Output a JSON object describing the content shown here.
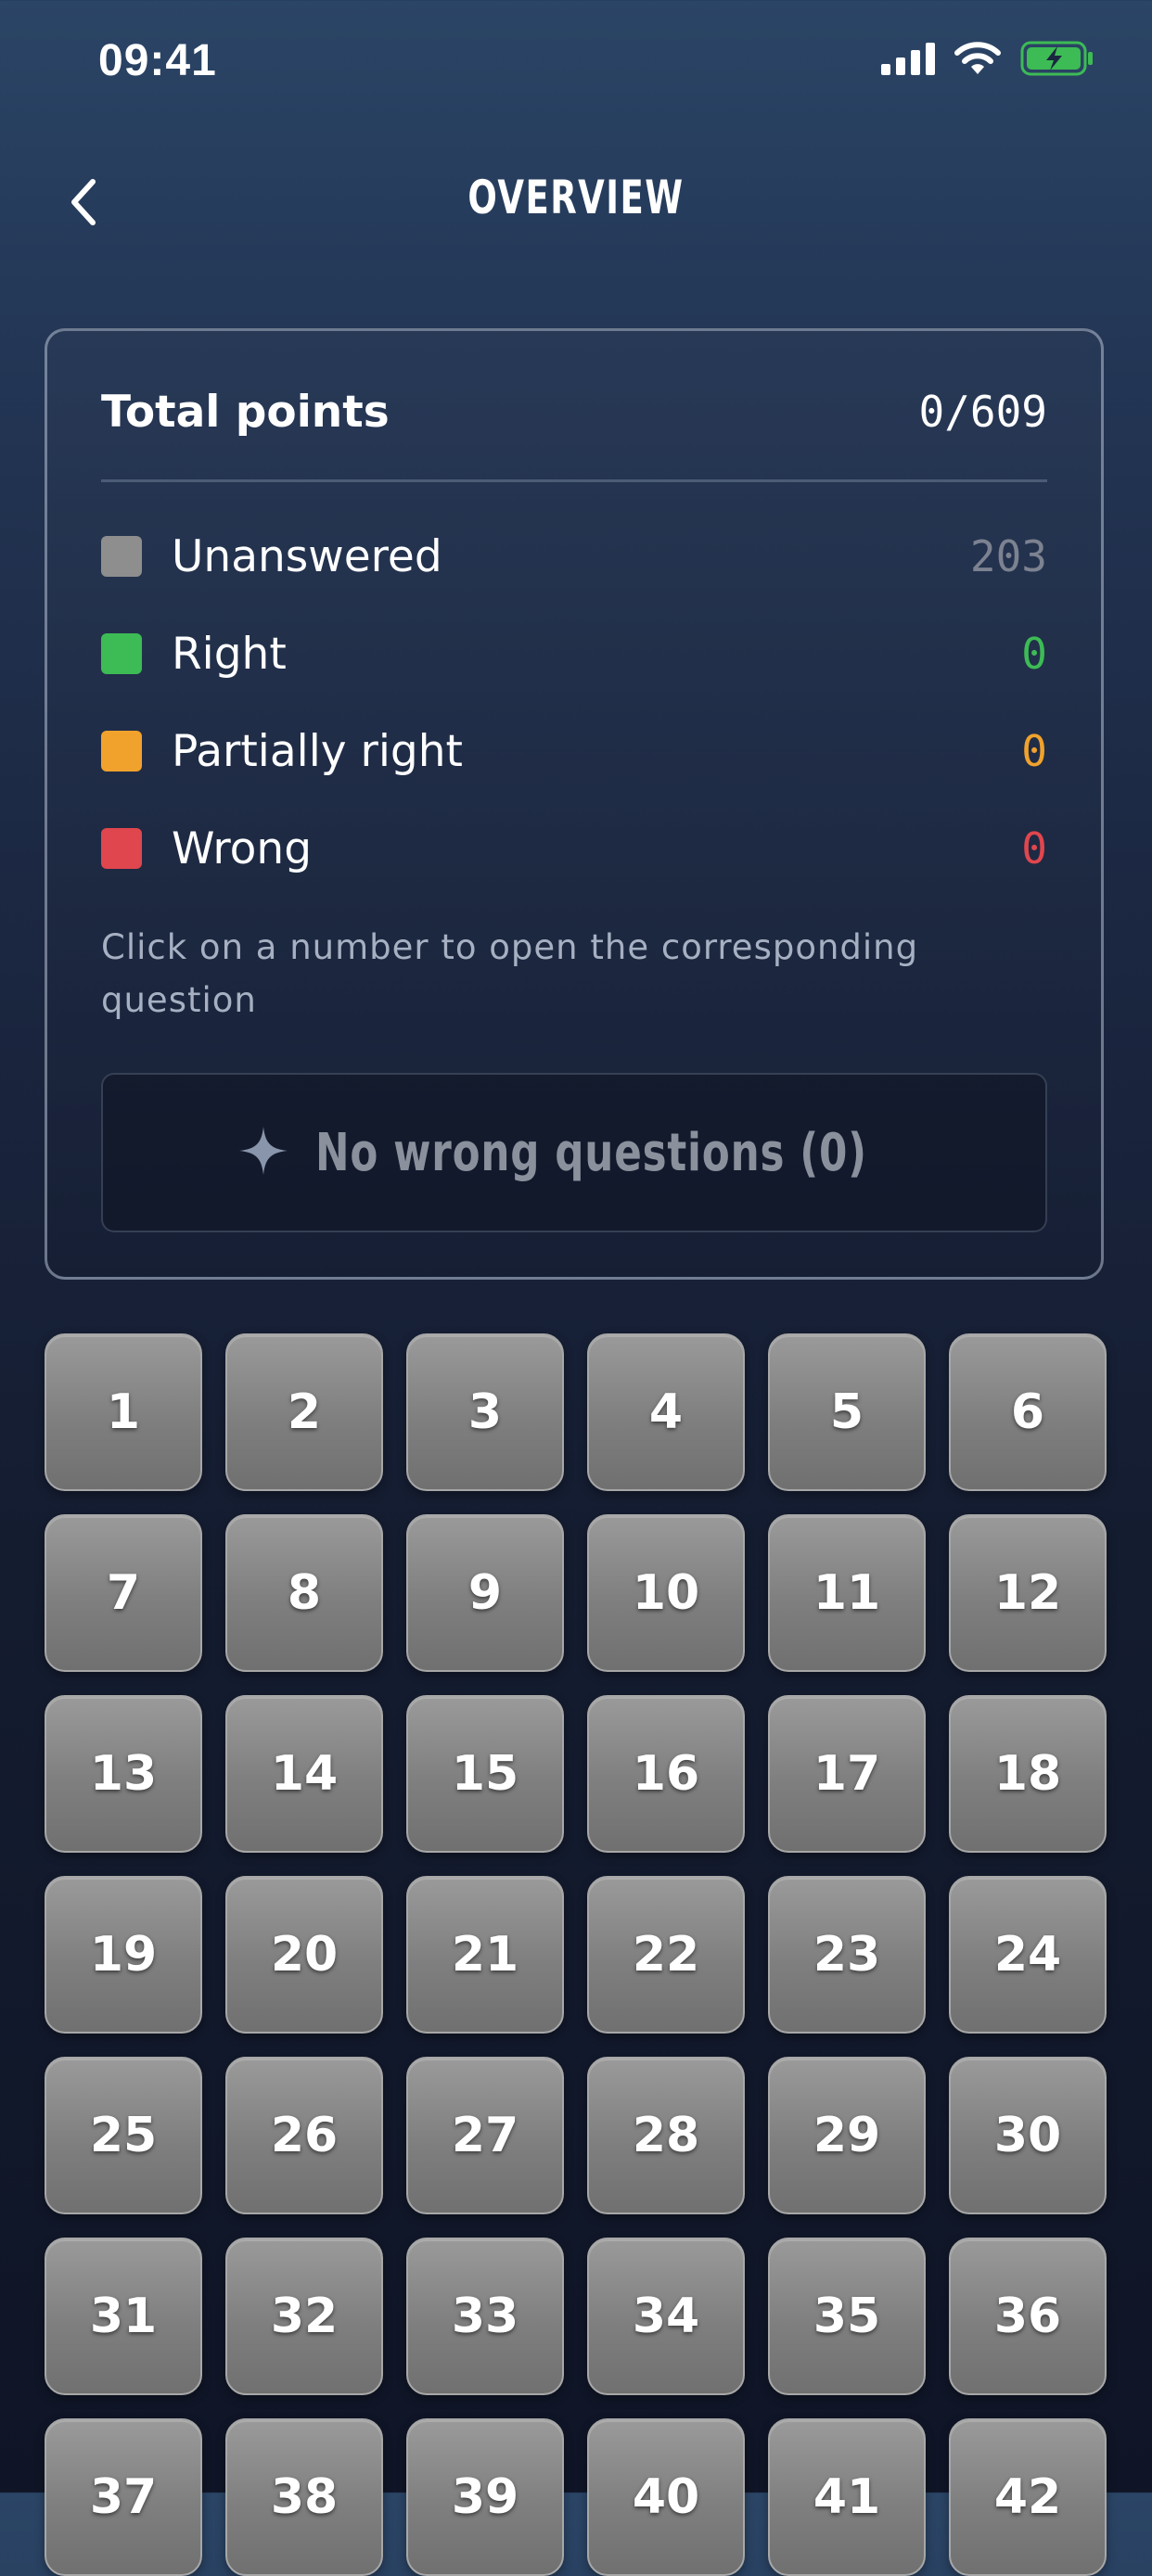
{
  "status_bar": {
    "time": "09:41"
  },
  "header": {
    "title": "OVERVIEW",
    "back_icon": "chevron-left-icon"
  },
  "summary": {
    "total_label": "Total points",
    "total_value": "0/609",
    "legend": [
      {
        "key": "unanswered",
        "label": "Unanswered",
        "count": "203",
        "color": "#8e8e8e",
        "count_color": "#7c8290"
      },
      {
        "key": "right",
        "label": "Right",
        "count": "0",
        "color": "#3dbb55",
        "count_color": "#3dbb55"
      },
      {
        "key": "partially-right",
        "label": "Partially right",
        "count": "0",
        "color": "#f0a22d",
        "count_color": "#f0a22d"
      },
      {
        "key": "wrong",
        "label": "Wrong",
        "count": "0",
        "color": "#e0464e",
        "count_color": "#e0464e"
      }
    ],
    "hint": "Click on a number to open the corresponding question",
    "wrong_questions_button": "No wrong questions (0)",
    "wrong_questions_icon": "sparkle-icon"
  },
  "questions": [
    "1",
    "2",
    "3",
    "4",
    "5",
    "6",
    "7",
    "8",
    "9",
    "10",
    "11",
    "12",
    "13",
    "14",
    "15",
    "16",
    "17",
    "18",
    "19",
    "20",
    "21",
    "22",
    "23",
    "24",
    "25",
    "26",
    "27",
    "28",
    "29",
    "30",
    "31",
    "32",
    "33",
    "34",
    "35",
    "36",
    "37",
    "38",
    "39",
    "40",
    "41",
    "42"
  ],
  "colors": {
    "tile_unanswered": "#8e8e8e",
    "background_top": "#2b4566",
    "background_bottom": "#0f1526"
  }
}
